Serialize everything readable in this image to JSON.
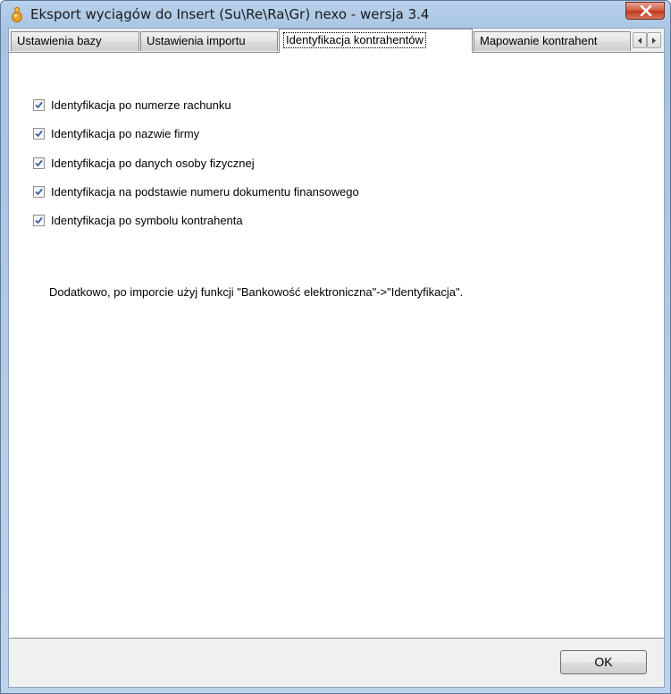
{
  "window": {
    "title": "Eksport wyciągów do Insert (Su\\Re\\Ra\\Gr) nexo - wersja 3.4"
  },
  "tabs": [
    {
      "label": "Ustawienia bazy",
      "active": false
    },
    {
      "label": "Ustawienia importu",
      "active": false
    },
    {
      "label": "Identyfikacja kontrahentów",
      "active": true
    },
    {
      "label": "Mapowanie kontrahent",
      "active": false
    }
  ],
  "options": [
    {
      "label": "Identyfikacja po numerze rachunku",
      "checked": true
    },
    {
      "label": "Identyfikacja po nazwie firmy",
      "checked": true
    },
    {
      "label": "Identyfikacja po danych osoby fizycznej",
      "checked": true
    },
    {
      "label": "Identyfikacja na podstawie numeru dokumentu finansowego",
      "checked": true
    },
    {
      "label": "Identyfikacja po symbolu kontrahenta",
      "checked": true
    }
  ],
  "info_text": "Dodatkowo, po imporcie użyj funkcji \"Bankowość elektroniczna\"->\"Identyfikacja\".",
  "buttons": {
    "ok_label": "OK"
  },
  "icons": {
    "app": "app-icon",
    "close": "close-icon",
    "scroll_left": "chevron-left-icon",
    "scroll_right": "chevron-right-icon",
    "check": "check-icon"
  }
}
